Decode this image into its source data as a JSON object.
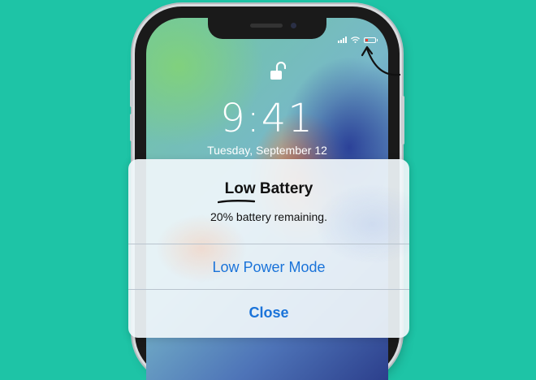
{
  "lock_screen": {
    "time": "9:41",
    "date": "Tuesday, September 12",
    "status_icons": [
      "signal-icon",
      "wifi-icon",
      "battery-icon"
    ],
    "lock_icon": "unlocked-padlock-icon",
    "battery_level_fraction": 0.2
  },
  "alert": {
    "title": "Low Battery",
    "message": "20% battery remaining.",
    "buttons": [
      {
        "label": "Low Power Mode"
      },
      {
        "label": "Close"
      }
    ]
  },
  "colors": {
    "background": "#1ec4a6",
    "button_text": "#1a73d9",
    "battery_low": "#ff3b30"
  }
}
